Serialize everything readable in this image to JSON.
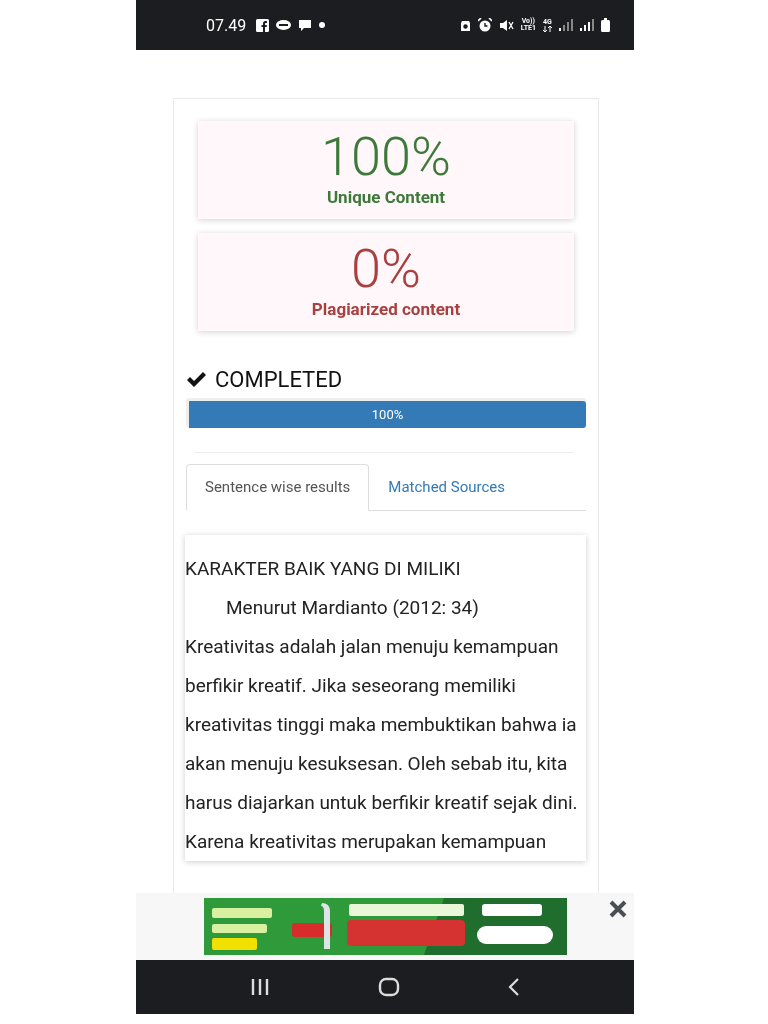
{
  "status_bar": {
    "time": "07.49",
    "network_labels": [
      "Vo))",
      "LTE1",
      "4G"
    ]
  },
  "scores": [
    {
      "kind": "unique",
      "value": "100%",
      "label": "Unique Content"
    },
    {
      "kind": "plagiarized",
      "value": "0%",
      "label": "Plagiarized content"
    }
  ],
  "status": {
    "text": "COMPLETED"
  },
  "progress": {
    "level": 1,
    "reading": "100%"
  },
  "tabs": [
    {
      "label": "Sentence wise results",
      "selected": true
    },
    {
      "label": "Matched Sources",
      "selected": false
    }
  ],
  "result_text": [
    {
      "kind": "heading",
      "text": "KARAKTER BAIK YANG DI MILIKI"
    },
    {
      "kind": "indented",
      "text": "Menurut Mardianto (2012: 34)"
    },
    {
      "kind": "body",
      "text": "Kreativitas adalah jalan menuju kemampuan berfikir kreatif. Jika seseorang memiliki kreativitas tinggi maka membuktikan bahwa ia akan menuju kesuksesan. Oleh sebab itu, kita harus diajarkan untuk berfikir kreatif sejak dini. Karena kreativitas merupakan kemampuan"
    }
  ]
}
